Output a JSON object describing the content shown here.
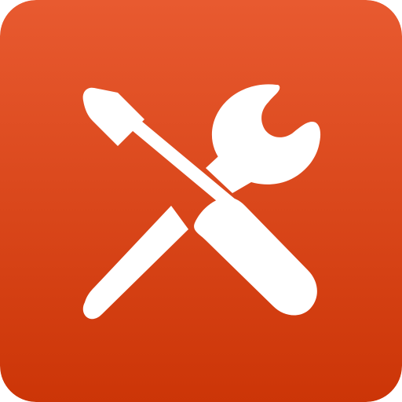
{
  "icon": {
    "name": "tools-icon",
    "glyph": "screwdriver-and-wrench",
    "colors": {
      "gradient_top": "#E85A30",
      "gradient_bottom": "#CC3507",
      "glyph": "#FFFFFF"
    }
  }
}
